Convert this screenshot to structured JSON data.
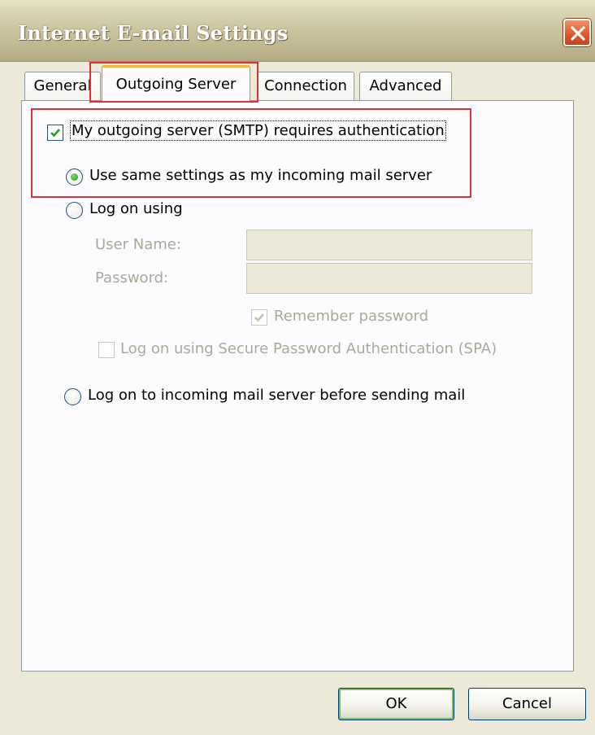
{
  "window": {
    "title": "Internet E-mail Settings"
  },
  "tabs": [
    {
      "label": "General"
    },
    {
      "label": "Outgoing Server"
    },
    {
      "label": "Connection"
    },
    {
      "label": "Advanced"
    }
  ],
  "outgoing": {
    "requires_auth_label": "My outgoing server (SMTP) requires authentication",
    "requires_auth_checked": true,
    "same_settings_label": "Use same settings as my incoming mail server",
    "log_on_using_label": "Log on using",
    "user_name_label": "User Name:",
    "user_name_value": "",
    "password_label": "Password:",
    "password_value": "",
    "remember_password_label": "Remember password",
    "remember_password_checked": true,
    "spa_label": "Log on using Secure Password Authentication (SPA)",
    "spa_checked": false,
    "log_on_incoming_label": "Log on to incoming mail server before sending mail",
    "selected_option": "same_settings"
  },
  "buttons": {
    "ok": "OK",
    "cancel": "Cancel"
  },
  "colors": {
    "highlight": "#e03030",
    "active_tab_accent": "#f3b53e",
    "check_green": "#21a121"
  }
}
